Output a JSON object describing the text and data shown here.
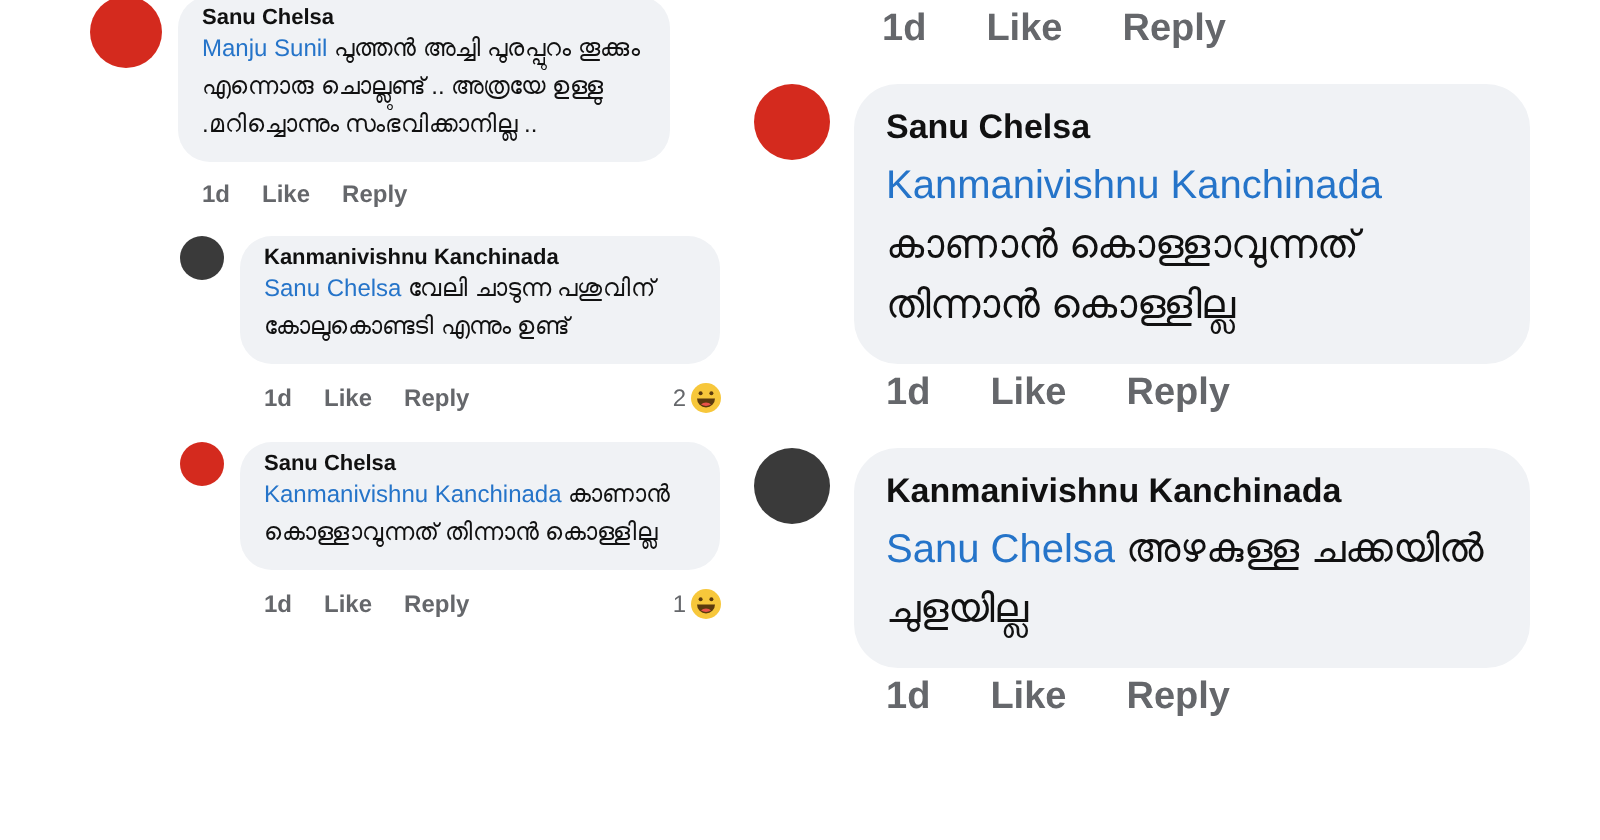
{
  "left_panel": {
    "comments": [
      {
        "author": "Sanu Chelsa",
        "color": "#d42a1e",
        "mention": "Manju Sunil",
        "text": "പുത്തൻ അച്ചി പുരപ്പുറം തൂക്കും എന്നൊരു ചൊല്ലുണ്ട് .. അത്രയേ ഉള്ളു .മറിച്ചൊന്നും സംഭവിക്കാനില്ല ..",
        "time": "1d",
        "like": "Like",
        "reply": "Reply",
        "children": [
          {
            "author": "Kanmanivishnu Kanchinada",
            "color": "#3a3a3a",
            "mention": "Sanu Chelsa",
            "text": "വേലി ചാടുന്ന പശുവിന് കോലുകൊണ്ടടി എന്നും ഉണ്ട്",
            "time": "1d",
            "like": "Like",
            "reply": "Reply",
            "reactions": "2"
          },
          {
            "author": "Sanu Chelsa",
            "color": "#d42a1e",
            "mention": "Kanmanivishnu Kanchinada",
            "text": "കാണാൻ കൊള്ളാവുന്നത് തിന്നാൻ കൊള്ളില്ല",
            "time": "1d",
            "like": "Like",
            "reply": "Reply",
            "reactions": "1"
          }
        ]
      }
    ]
  },
  "right_panel": {
    "top_meta": {
      "time": "1d",
      "like": "Like",
      "reply": "Reply"
    },
    "comments": [
      {
        "author": "Sanu Chelsa",
        "color": "#d42a1e",
        "mention": "Kanmanivishnu Kanchinada",
        "text": "കാണാൻ കൊള്ളാവുന്നത് തിന്നാൻ കൊള്ളില്ല",
        "time": "1d",
        "like": "Like",
        "reply": "Reply"
      },
      {
        "author": "Kanmanivishnu Kanchinada",
        "color": "#3a3a3a",
        "mention": "Sanu Chelsa",
        "text": "അഴകുള്ള ചക്കയിൽ ചുളയില്ല",
        "time": "1d",
        "like": "Like",
        "reply": "Reply"
      }
    ]
  }
}
